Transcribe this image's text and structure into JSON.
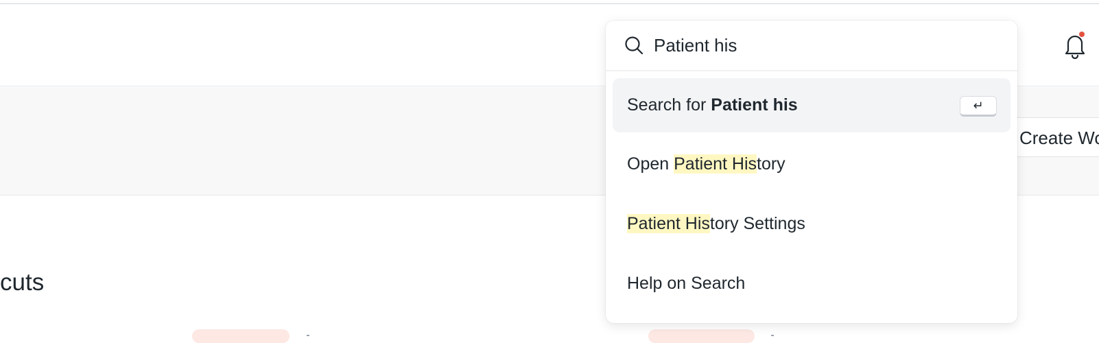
{
  "navbar": {
    "notifications_icon": "bell-icon",
    "notification_dot_color": "#e2523f"
  },
  "page": {
    "create_button_label": "Create Wo",
    "section_title": "cuts"
  },
  "search": {
    "icon": "search-icon",
    "value": "Patient his",
    "results": {
      "search_for": {
        "prefix": "Search for ",
        "query": "Patient his",
        "key_hint": "↵"
      },
      "open_history": {
        "prefix": "Open ",
        "match": "Patient His",
        "rest": "tory"
      },
      "history_settings": {
        "match": "Patient His",
        "rest": "tory Settings"
      },
      "help": {
        "label": "Help on Search"
      }
    },
    "highlight_color": "#fff7c2"
  }
}
